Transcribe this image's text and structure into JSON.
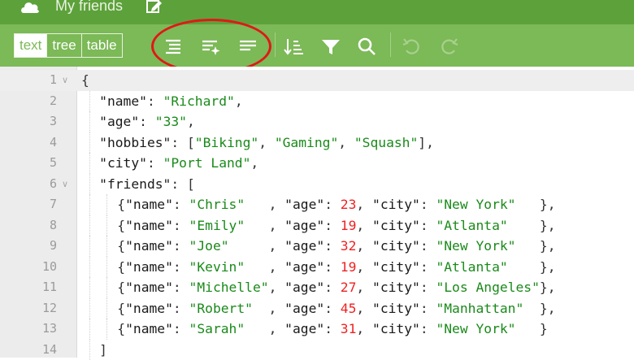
{
  "window": {
    "title": "My friends"
  },
  "colors": {
    "header": "#5da13b",
    "toolbar": "#7cb957",
    "string": "#1a8a1a",
    "number": "#ee2222",
    "annotation": "#e01818"
  },
  "toolbar": {
    "modes": [
      {
        "label": "text",
        "active": true
      },
      {
        "label": "tree",
        "active": false
      },
      {
        "label": "table",
        "active": false
      }
    ],
    "buttons": [
      {
        "name": "format-button",
        "icon": "format-icon"
      },
      {
        "name": "compact-button",
        "icon": "compact-icon"
      },
      {
        "name": "repair-button",
        "icon": "repair-icon"
      },
      {
        "name": "sort-button",
        "icon": "sort-icon"
      },
      {
        "name": "filter-button",
        "icon": "filter-icon"
      },
      {
        "name": "search-button",
        "icon": "search-icon"
      },
      {
        "name": "undo-button",
        "icon": "undo-icon",
        "enabled": false
      },
      {
        "name": "redo-button",
        "icon": "redo-icon",
        "enabled": false
      }
    ]
  },
  "editor": {
    "lines": [
      {
        "num": "1",
        "fold": true,
        "indent": 0,
        "tokens": [
          [
            "p",
            "{"
          ]
        ]
      },
      {
        "num": "2",
        "indent": 1,
        "tokens": [
          [
            "k",
            "\"name\""
          ],
          [
            "p",
            ": "
          ],
          [
            "s",
            "\"Richard\""
          ],
          [
            "p",
            ","
          ]
        ]
      },
      {
        "num": "3",
        "indent": 1,
        "tokens": [
          [
            "k",
            "\"age\""
          ],
          [
            "p",
            ": "
          ],
          [
            "s",
            "\"33\""
          ],
          [
            "p",
            ","
          ]
        ]
      },
      {
        "num": "4",
        "indent": 1,
        "tokens": [
          [
            "k",
            "\"hobbies\""
          ],
          [
            "p",
            ": ["
          ],
          [
            "s",
            "\"Biking\""
          ],
          [
            "p",
            ", "
          ],
          [
            "s",
            "\"Gaming\""
          ],
          [
            "p",
            ", "
          ],
          [
            "s",
            "\"Squash\""
          ],
          [
            "p",
            "],"
          ]
        ]
      },
      {
        "num": "5",
        "indent": 1,
        "tokens": [
          [
            "k",
            "\"city\""
          ],
          [
            "p",
            ": "
          ],
          [
            "s",
            "\"Port Land\""
          ],
          [
            "p",
            ","
          ]
        ]
      },
      {
        "num": "6",
        "fold": true,
        "indent": 1,
        "tokens": [
          [
            "k",
            "\"friends\""
          ],
          [
            "p",
            ": ["
          ]
        ]
      },
      {
        "num": "7",
        "indent": 2,
        "tokens": [
          [
            "p",
            "{"
          ],
          [
            "k",
            "\"name\""
          ],
          [
            "p",
            ": "
          ],
          [
            "s",
            "\"Chris\""
          ],
          [
            "p",
            "   , "
          ],
          [
            "k",
            "\"age\""
          ],
          [
            "p",
            ": "
          ],
          [
            "n",
            "23"
          ],
          [
            "p",
            ", "
          ],
          [
            "k",
            "\"city\""
          ],
          [
            "p",
            ": "
          ],
          [
            "s",
            "\"New York\""
          ],
          [
            "p",
            "   },"
          ]
        ]
      },
      {
        "num": "8",
        "indent": 2,
        "tokens": [
          [
            "p",
            "{"
          ],
          [
            "k",
            "\"name\""
          ],
          [
            "p",
            ": "
          ],
          [
            "s",
            "\"Emily\""
          ],
          [
            "p",
            "   , "
          ],
          [
            "k",
            "\"age\""
          ],
          [
            "p",
            ": "
          ],
          [
            "n",
            "19"
          ],
          [
            "p",
            ", "
          ],
          [
            "k",
            "\"city\""
          ],
          [
            "p",
            ": "
          ],
          [
            "s",
            "\"Atlanta\""
          ],
          [
            "p",
            "    },"
          ]
        ]
      },
      {
        "num": "9",
        "indent": 2,
        "tokens": [
          [
            "p",
            "{"
          ],
          [
            "k",
            "\"name\""
          ],
          [
            "p",
            ": "
          ],
          [
            "s",
            "\"Joe\""
          ],
          [
            "p",
            "     , "
          ],
          [
            "k",
            "\"age\""
          ],
          [
            "p",
            ": "
          ],
          [
            "n",
            "32"
          ],
          [
            "p",
            ", "
          ],
          [
            "k",
            "\"city\""
          ],
          [
            "p",
            ": "
          ],
          [
            "s",
            "\"New York\""
          ],
          [
            "p",
            "   },"
          ]
        ]
      },
      {
        "num": "10",
        "indent": 2,
        "tokens": [
          [
            "p",
            "{"
          ],
          [
            "k",
            "\"name\""
          ],
          [
            "p",
            ": "
          ],
          [
            "s",
            "\"Kevin\""
          ],
          [
            "p",
            "   , "
          ],
          [
            "k",
            "\"age\""
          ],
          [
            "p",
            ": "
          ],
          [
            "n",
            "19"
          ],
          [
            "p",
            ", "
          ],
          [
            "k",
            "\"city\""
          ],
          [
            "p",
            ": "
          ],
          [
            "s",
            "\"Atlanta\""
          ],
          [
            "p",
            "    },"
          ]
        ]
      },
      {
        "num": "11",
        "indent": 2,
        "tokens": [
          [
            "p",
            "{"
          ],
          [
            "k",
            "\"name\""
          ],
          [
            "p",
            ": "
          ],
          [
            "s",
            "\"Michelle\""
          ],
          [
            "p",
            ", "
          ],
          [
            "k",
            "\"age\""
          ],
          [
            "p",
            ": "
          ],
          [
            "n",
            "27"
          ],
          [
            "p",
            ", "
          ],
          [
            "k",
            "\"city\""
          ],
          [
            "p",
            ": "
          ],
          [
            "s",
            "\"Los Angeles\""
          ],
          [
            "p",
            "},"
          ]
        ]
      },
      {
        "num": "12",
        "indent": 2,
        "tokens": [
          [
            "p",
            "{"
          ],
          [
            "k",
            "\"name\""
          ],
          [
            "p",
            ": "
          ],
          [
            "s",
            "\"Robert\""
          ],
          [
            "p",
            "  , "
          ],
          [
            "k",
            "\"age\""
          ],
          [
            "p",
            ": "
          ],
          [
            "n",
            "45"
          ],
          [
            "p",
            ", "
          ],
          [
            "k",
            "\"city\""
          ],
          [
            "p",
            ": "
          ],
          [
            "s",
            "\"Manhattan\""
          ],
          [
            "p",
            "  },"
          ]
        ]
      },
      {
        "num": "13",
        "indent": 2,
        "tokens": [
          [
            "p",
            "{"
          ],
          [
            "k",
            "\"name\""
          ],
          [
            "p",
            ": "
          ],
          [
            "s",
            "\"Sarah\""
          ],
          [
            "p",
            "   , "
          ],
          [
            "k",
            "\"age\""
          ],
          [
            "p",
            ": "
          ],
          [
            "n",
            "31"
          ],
          [
            "p",
            ", "
          ],
          [
            "k",
            "\"city\""
          ],
          [
            "p",
            ": "
          ],
          [
            "s",
            "\"New York\""
          ],
          [
            "p",
            "   }"
          ]
        ]
      },
      {
        "num": "14",
        "indent": 1,
        "tokens": [
          [
            "p",
            "]"
          ]
        ]
      }
    ]
  }
}
